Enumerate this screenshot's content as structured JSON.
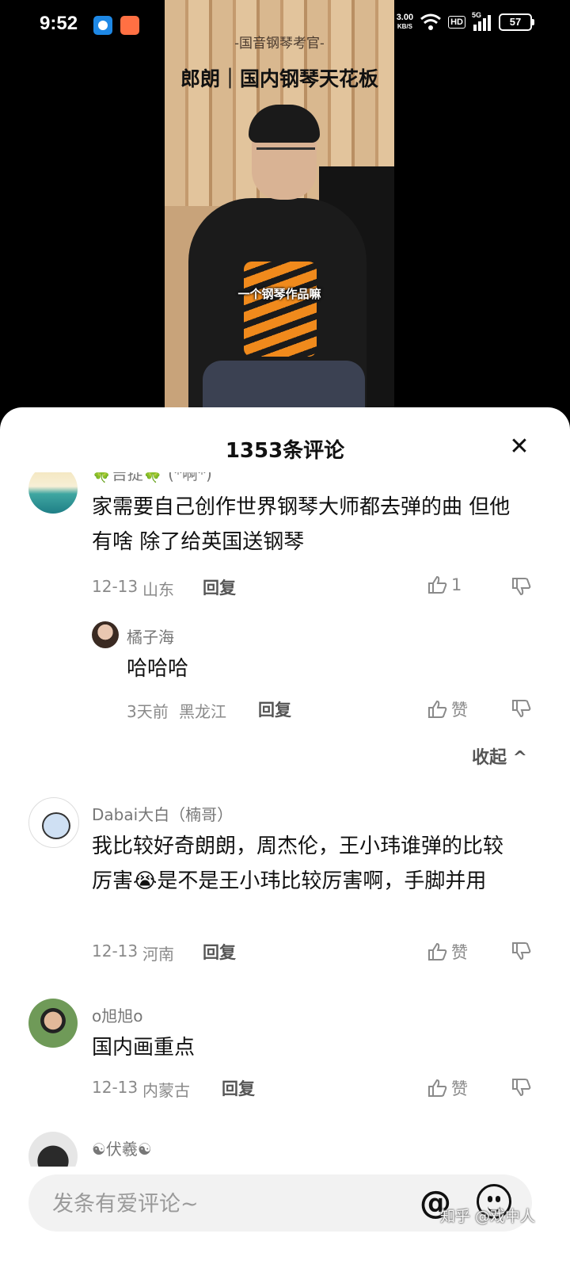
{
  "status_bar": {
    "time": "9:52",
    "net_speed": "3.00",
    "net_unit": "KB/S",
    "hd": "HD",
    "signal": "5G",
    "battery": "57"
  },
  "video": {
    "subtitle": "-国音钢琴考官-",
    "title": "郎朗｜国内钢琴天花板",
    "caption": "一个钢琴作品嘛"
  },
  "comments_sheet": {
    "title": "1353条评论",
    "close_icon": "close-icon",
    "comments": [
      {
        "name": "🍀吉捉🍀 (*啊*)",
        "text": "家需要自己创作世界钢琴大师都去弹的曲 但他有啥 除了给英国送钢琴",
        "date": "12-13",
        "region": "山东",
        "reply": "回复",
        "likes": "1"
      },
      {
        "name": "橘子海",
        "text": "哈哈哈",
        "date": "3天前",
        "region": "黑龙江",
        "reply": "回复",
        "likes": "赞"
      },
      {
        "name": "Dabai大白（楠哥）",
        "text": "我比较好奇朗朗，周杰伦，王小玮谁弹的比较厉害😭是不是王小玮比较厉害啊，手脚并用",
        "date": "12-13",
        "region": "河南",
        "reply": "回复",
        "likes": "赞"
      },
      {
        "name": "o旭旭o",
        "text": "国内画重点",
        "date": "12-13",
        "region": "内蒙古",
        "reply": "回复",
        "likes": "赞"
      },
      {
        "name": "☯伏羲☯",
        "text": ""
      }
    ],
    "collapse_label": "收起 ^"
  },
  "input": {
    "placeholder": "发条有爱评论~",
    "at_icon": "@",
    "emoji_icon": "emoji-icon"
  },
  "watermark": "知乎 @戏中人"
}
